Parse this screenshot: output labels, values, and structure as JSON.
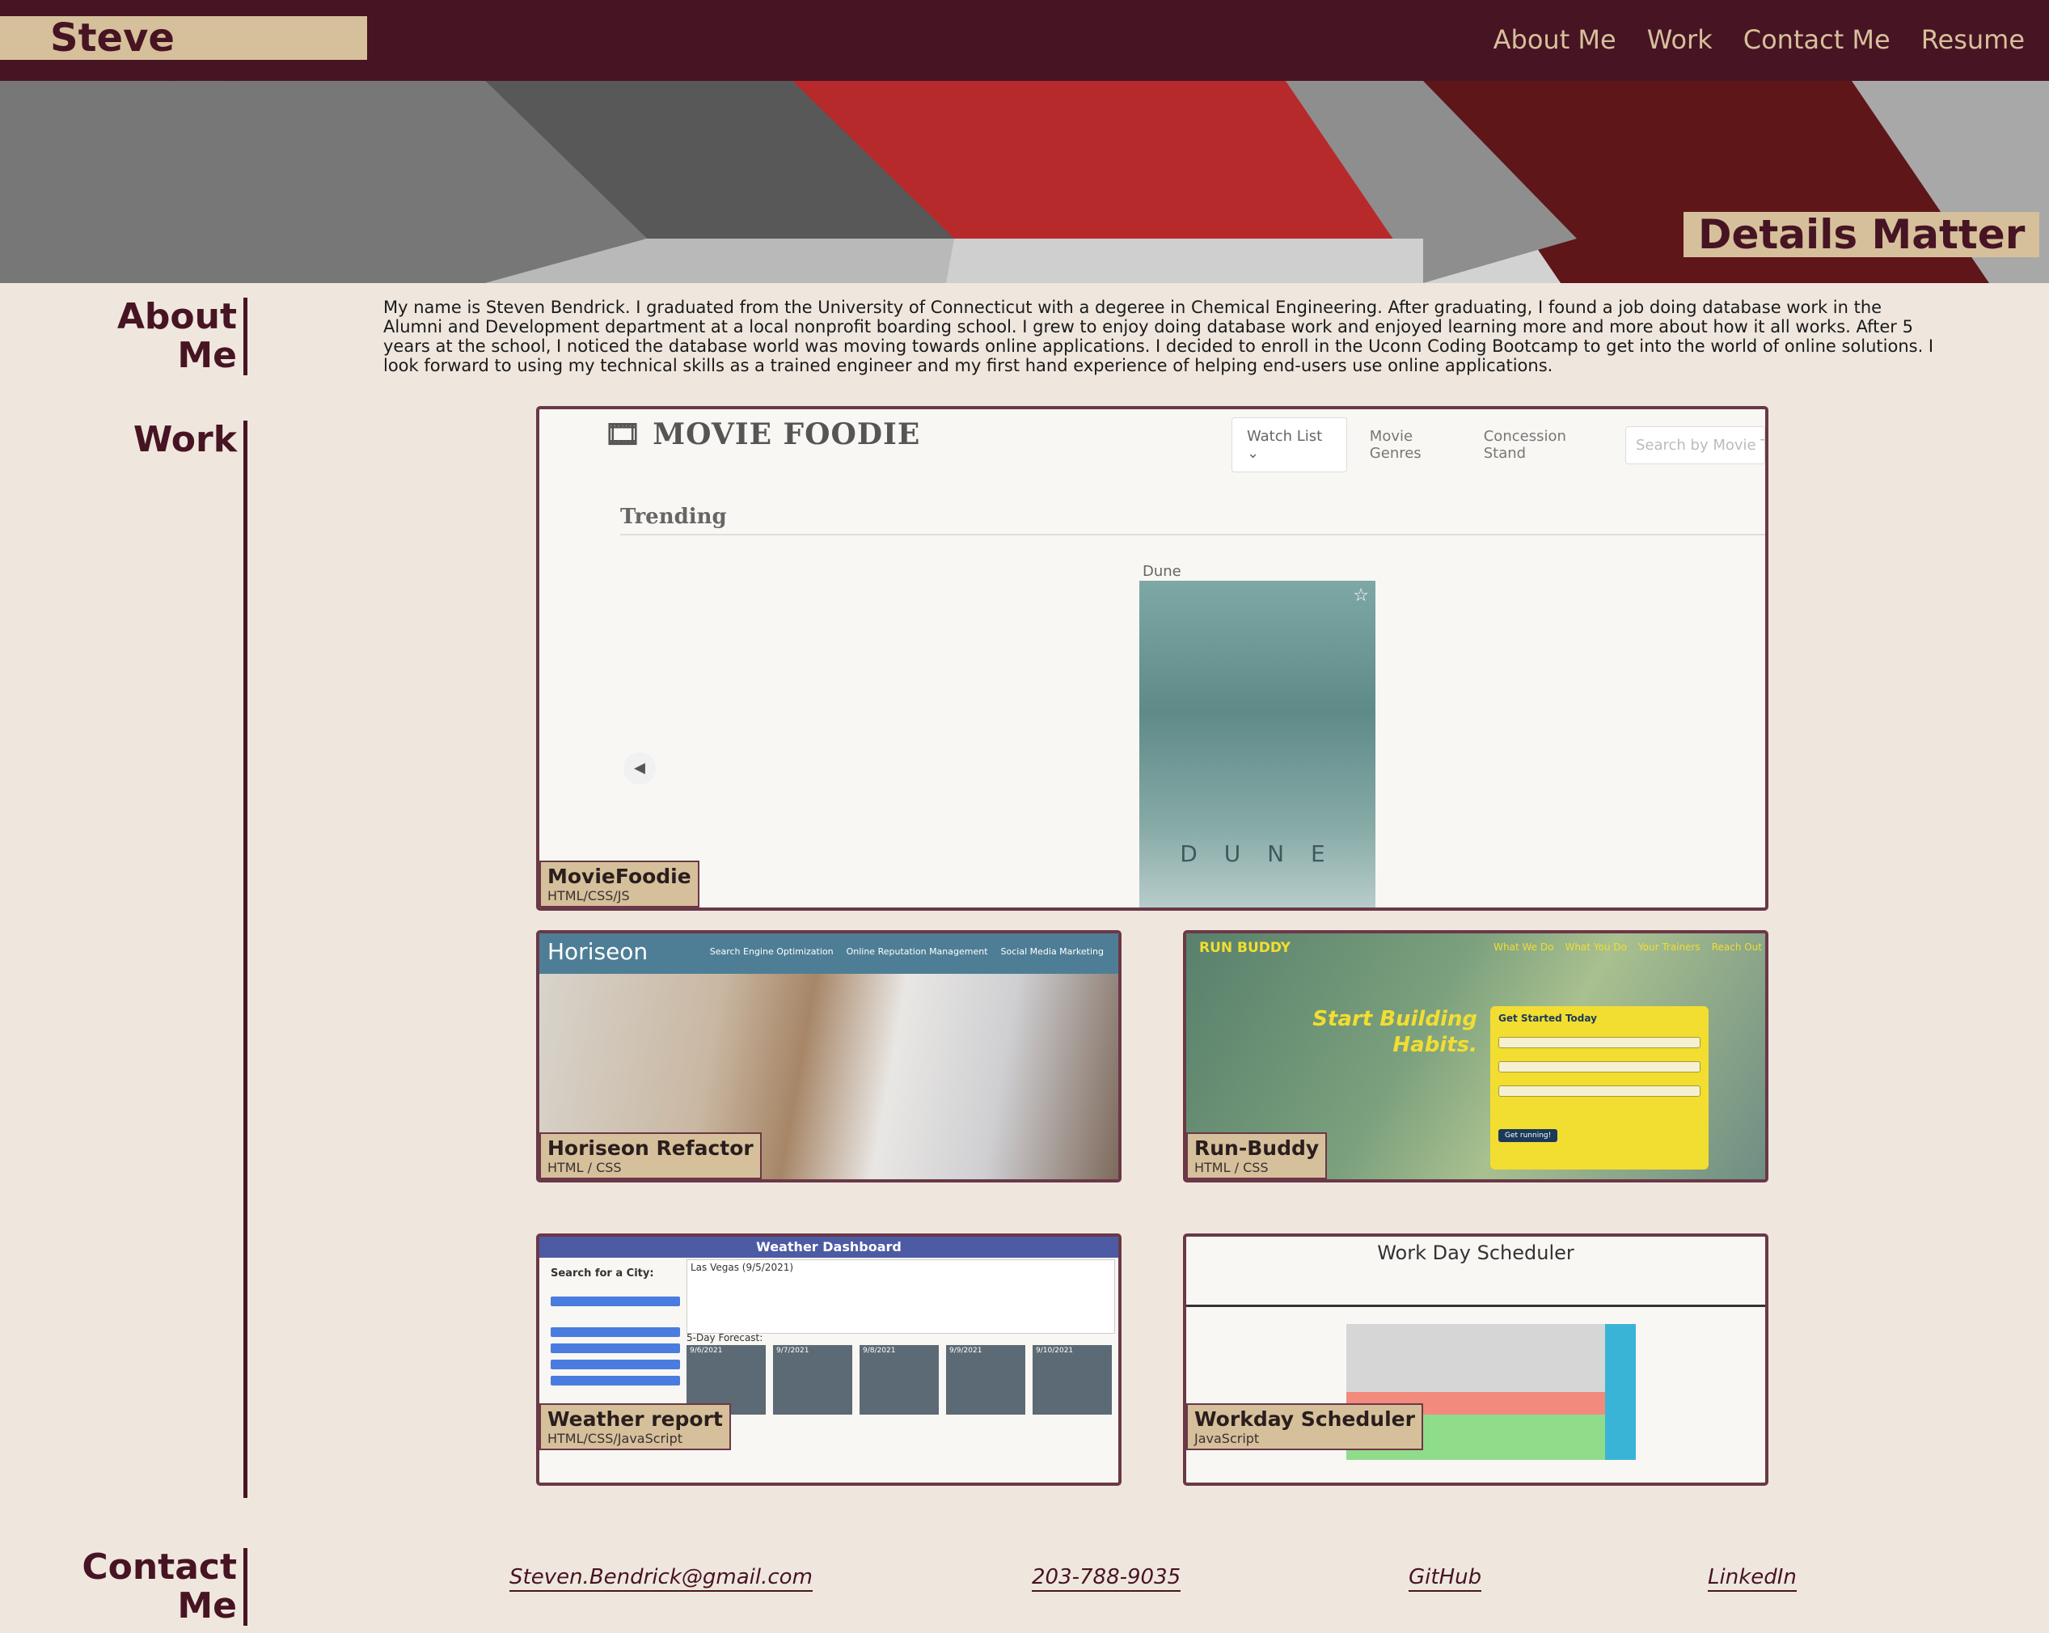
{
  "header": {
    "brand": "Steve Bendrick",
    "nav": [
      "About Me",
      "Work",
      "Contact Me",
      "Resume"
    ]
  },
  "banner": {
    "tagline": "Details Matter"
  },
  "about": {
    "title": "About Me",
    "text": "My name is Steven Bendrick. I graduated from the University of Connecticut with a degeree in Chemical Engineering. After graduating, I found a job doing database work in the Alumni and Development department at a local nonprofit boarding school. I grew to enjoy doing database work and enjoyed learning more and more about how it all works. After 5 years at the school, I noticed the database world was moving towards online applications. I decided to enroll in the Uconn Coding Bootcamp to get into the world of online solutions. I look forward to using my technical skills as a trained engineer and my first hand experience of helping end-users use online applications."
  },
  "work": {
    "title": "Work",
    "projects": [
      {
        "title": "MovieFoodie",
        "tech": "HTML/CSS/JS",
        "shot": {
          "logo": "🎞 MOVIE FOODIE",
          "nav": [
            "Watch List ⌄",
            "Movie Genres",
            "Concession Stand"
          ],
          "search_placeholder": "Search by Movie Title",
          "section": "Trending",
          "movie": "Dune",
          "poster_text": "D U N E"
        }
      },
      {
        "title": "Horiseon Refactor",
        "tech": "HTML / CSS",
        "shot": {
          "logo": "Horiseon",
          "nav": [
            "Search Engine Optimization",
            "Online Reputation Management",
            "Social Media Marketing"
          ]
        }
      },
      {
        "title": "Run-Buddy",
        "tech": "HTML / CSS",
        "shot": {
          "logo": "RUN BUDDY",
          "nav": [
            "What We Do",
            "What You Do",
            "Your Trainers",
            "Reach Out"
          ],
          "headline": "Start Building Habits.",
          "form_title": "Get Started Today",
          "button": "Get running!"
        }
      },
      {
        "title": "Weather report",
        "tech": "HTML/CSS/JavaScript",
        "shot": {
          "title": "Weather Dashboard",
          "search_label": "Search for a City:",
          "city": "Las Vegas (9/5/2021)",
          "forecast_label": "5-Day Forecast:",
          "days": [
            "9/6/2021",
            "9/7/2021",
            "9/8/2021",
            "9/9/2021",
            "9/10/2021"
          ]
        }
      },
      {
        "title": "Workday Scheduler",
        "tech": "JavaScript",
        "shot": {
          "title": "Work Day Scheduler"
        }
      }
    ]
  },
  "contact": {
    "title": "Contact Me",
    "links": [
      "Steven.Bendrick@gmail.com",
      "203-788-9035",
      "GitHub",
      "LinkedIn"
    ]
  },
  "colors": {
    "header_bg": "#471423",
    "accent_tan": "#d6c09b",
    "page_bg": "#efe7de",
    "banner_red": "#b72a2c",
    "banner_maroon": "#5e1619"
  }
}
